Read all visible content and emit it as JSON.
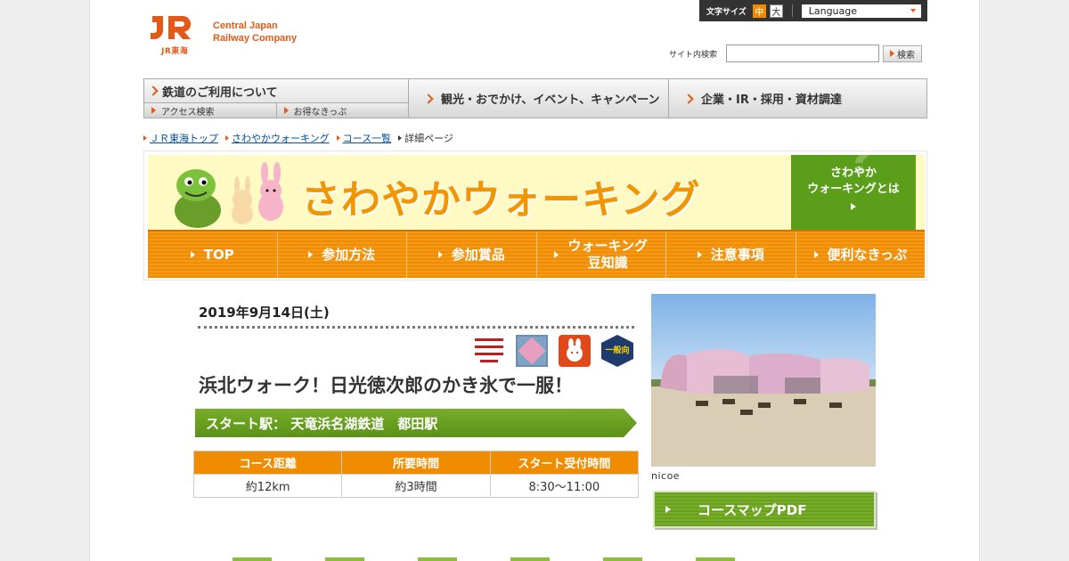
{
  "header": {
    "logo_sub": "JR東海",
    "company_line1": "Central Japan",
    "company_line2": "Railway Company",
    "font_size_label": "文字サイズ",
    "font_size_mid": "中",
    "font_size_big": "大",
    "language": "Language",
    "search_label": "サイト内検索",
    "search_value": "",
    "search_button": "検索"
  },
  "gnav": {
    "railway": "鉄道のご利用について",
    "access": "アクセス検索",
    "tickets": "お得なきっぷ",
    "sightseeing": "観光・おでかけ、イベント、キャンペーン",
    "corporate": "企業・IR・採用・資材調達"
  },
  "breadcrumb": {
    "items": [
      "ＪＲ東海トップ",
      "さわやかウォーキング",
      "コース一覧"
    ],
    "current": "詳細ページ"
  },
  "banner": {
    "title": "さわやかウォーキング",
    "about_line1": "さわやか",
    "about_line2": "ウォーキングとは",
    "about_q": "?",
    "tabs": [
      "TOP",
      "参加方法",
      "参加賞品",
      "ウォーキング",
      "注意事項",
      "便利なきっぷ"
    ],
    "tab4_line2": "豆知識"
  },
  "course": {
    "date": "2019年9月14日(土)",
    "badge_general": "一般向",
    "title": "浜北ウォーク！日光徳次郎のかき氷で一服！",
    "start_station": "スタート駅：  天竜浜名湖鉄道　都田駅",
    "table_headers": [
      "コース距離",
      "所要時間",
      "スタート受付時間"
    ],
    "table_values": [
      "約12km",
      "約3時間",
      "8:30～11:00"
    ],
    "photo_caption": "nicoe",
    "pdf_button": "コースマップPDF"
  },
  "colors": {
    "brand_orange": "#e25a17",
    "tab_orange": "#f08c00",
    "green": "#5a9e1a"
  }
}
